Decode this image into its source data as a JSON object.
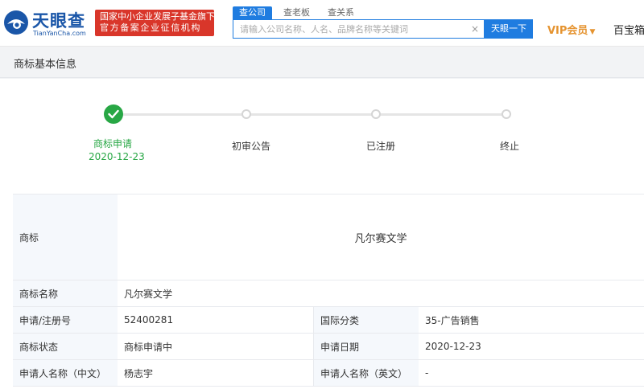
{
  "brand": {
    "name": "天眼查",
    "domain": "TianYanCha.com",
    "badge_line1": "国家中小企业发展子基金旗下",
    "badge_line2": "官方备案企业征信机构"
  },
  "search": {
    "tabs": [
      "查公司",
      "查老板",
      "查关系"
    ],
    "placeholder": "请输入公司名称、人名、品牌名称等关键词",
    "button": "天眼一下",
    "clear": "×"
  },
  "nav": {
    "vip": "VIP会员",
    "treasure": "百宝箱"
  },
  "section": {
    "title": "商标基本信息"
  },
  "progress": {
    "steps": [
      {
        "label": "商标申请",
        "date": "2020-12-23",
        "done": true
      },
      {
        "label": "初审公告",
        "done": false
      },
      {
        "label": "已注册",
        "done": false
      },
      {
        "label": "终止",
        "done": false
      }
    ]
  },
  "info": {
    "trademark_label": "商标",
    "trademark_text": "凡尔赛文学",
    "name_label": "商标名称",
    "name_value": "凡尔赛文学",
    "reg_no_label": "申请/注册号",
    "reg_no_value": "52400281",
    "intl_class_label": "国际分类",
    "intl_class_value": "35-广告销售",
    "status_label": "商标状态",
    "status_value": "商标申请中",
    "apply_date_label": "申请日期",
    "apply_date_value": "2020-12-23",
    "applicant_cn_label": "申请人名称（中文）",
    "applicant_cn_value": "杨志宇",
    "applicant_en_label": "申请人名称（英文）",
    "applicant_en_value": "-"
  },
  "colors": {
    "brand_blue": "#1a56a8",
    "search_blue": "#1f7ce0",
    "badge_red": "#d9362a",
    "vip_orange": "#e5932f",
    "success_green": "#28a745"
  }
}
